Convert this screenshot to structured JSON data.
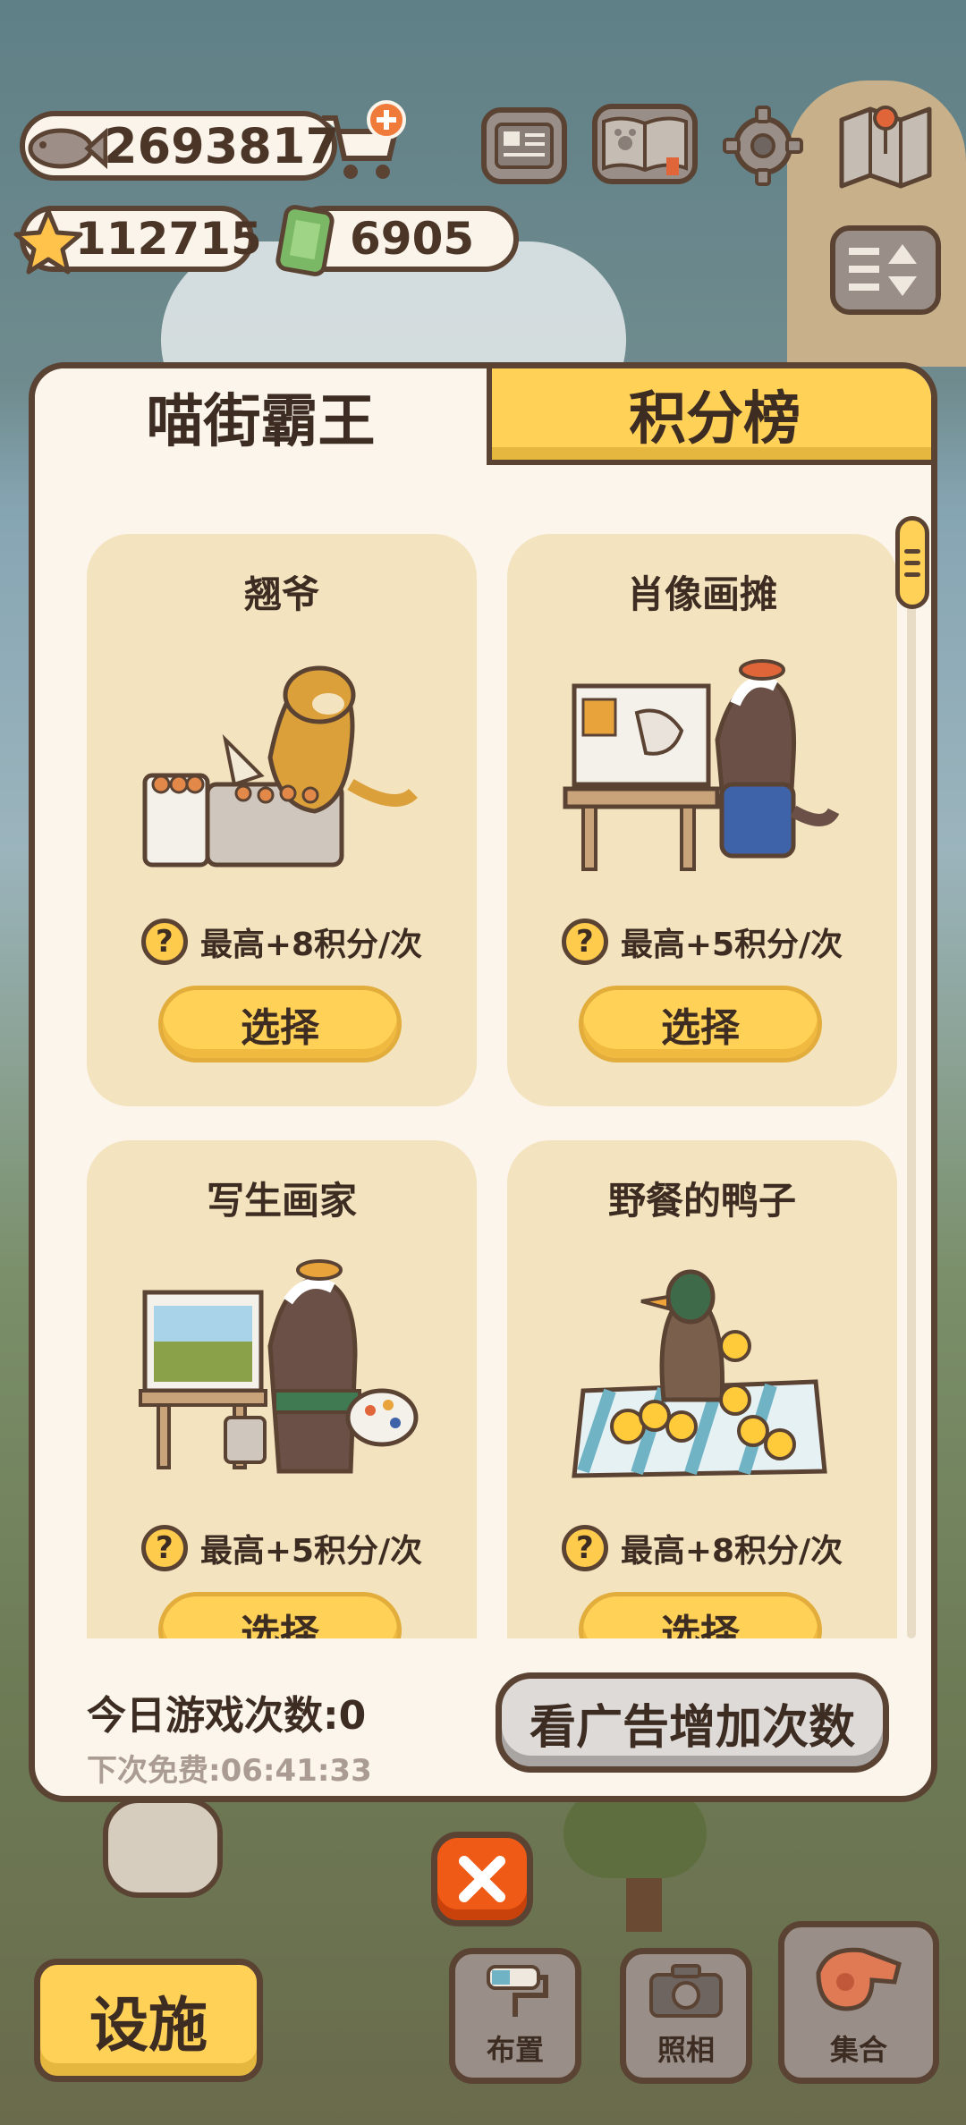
{
  "hud": {
    "fish_coins": "2693817",
    "stars": "112715",
    "tickets": "6905"
  },
  "panel": {
    "tabs": [
      {
        "label": "喵街霸王",
        "active": true
      },
      {
        "label": "积分榜",
        "active": false
      }
    ],
    "cards": [
      {
        "title": "翘爷",
        "info": "最高+8积分/次",
        "button": "选择"
      },
      {
        "title": "肖像画摊",
        "info": "最高+5积分/次",
        "button": "选择"
      },
      {
        "title": "写生画家",
        "info": "最高+5积分/次",
        "button": "选择"
      },
      {
        "title": "野餐的鸭子",
        "info": "最高+8积分/次",
        "button": "选择"
      }
    ],
    "games_today": "今日游戏次数:0",
    "next_free": "下次免费:06:41:33",
    "ad_button": "看广告增加次数"
  },
  "toolbar": {
    "facility": "设施",
    "layout": "布置",
    "photo": "照相",
    "gather": "集合"
  },
  "colors": {
    "accent_yellow": "#ffd157",
    "border_brown": "#5b4334",
    "panel_bg": "#fbf5ec",
    "card_bg": "#f4e3bf",
    "close_orange": "#ef5a16"
  },
  "icons": [
    "fish-icon",
    "cart-plus-icon",
    "star-icon",
    "ticket-icon",
    "news-icon",
    "paw-book-icon",
    "gear-icon",
    "map-icon",
    "sort-icon",
    "question-icon",
    "close-icon",
    "paint-roller-icon",
    "camera-icon",
    "whistle-icon"
  ]
}
